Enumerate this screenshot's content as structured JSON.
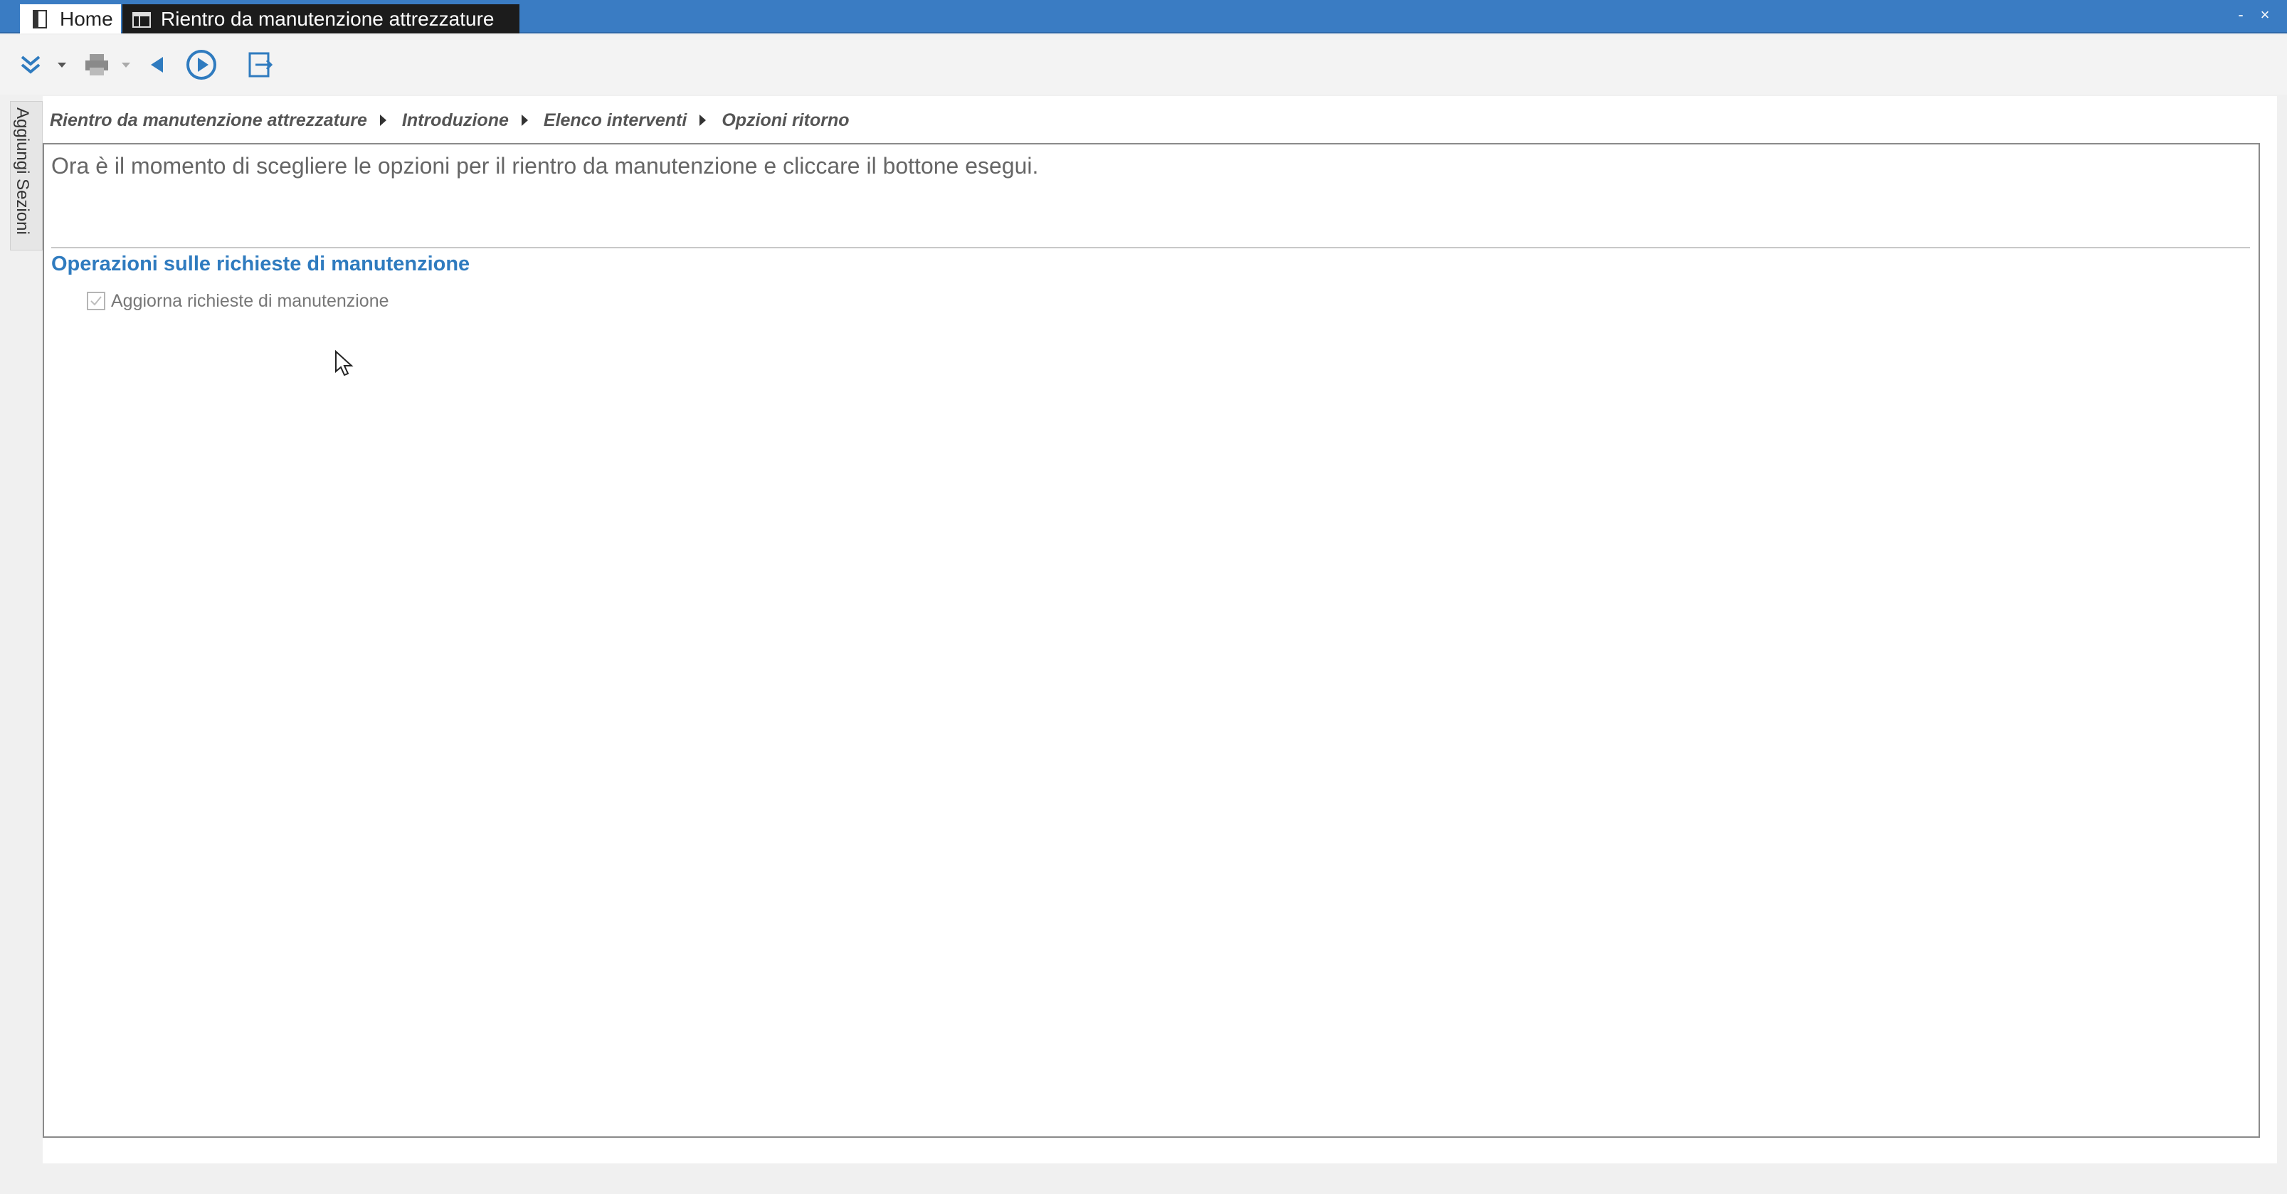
{
  "titlebar": {
    "tabs": [
      {
        "label": "Home",
        "icon": "document-icon"
      },
      {
        "label": "Rientro da manutenzione attrezzature",
        "icon": "window-icon"
      }
    ],
    "controls": {
      "minimize": "-",
      "close": "×"
    },
    "accent": "#3a7cc3"
  },
  "toolbar": {
    "buttons": [
      "expand-icon",
      "print-icon",
      "back-icon",
      "play-icon",
      "exit-icon"
    ]
  },
  "sidetab": {
    "label": "Aggiungi Sezioni"
  },
  "breadcrumb": {
    "items": [
      "Rientro da manutenzione attrezzature",
      "Introduzione",
      "Elenco interventi",
      "Opzioni ritorno"
    ]
  },
  "intro": {
    "text": "Ora è il momento di scegliere le opzioni per il rientro da manutenzione e cliccare il bottone esegui."
  },
  "section": {
    "title": "Operazioni sulle richieste di manutenzione",
    "checkbox_label": "Aggiorna richieste di manutenzione",
    "checkbox_checked": true
  },
  "colors": {
    "section_title": "#2f7bbf",
    "active_tab": "#1c1c1c"
  }
}
